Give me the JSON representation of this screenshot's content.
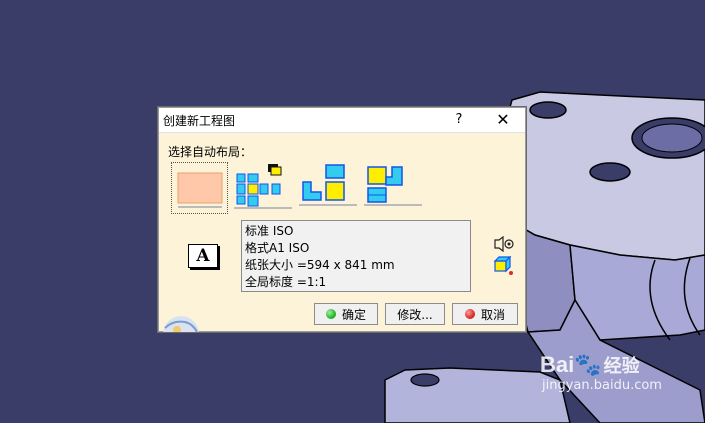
{
  "dialog": {
    "title": "创建新工程图",
    "help_label": "?",
    "close_label": "✕",
    "section_label": "选择自动布局：",
    "layout_options": [
      {
        "name": "empty-sheet"
      },
      {
        "name": "all-views"
      },
      {
        "name": "front-bottom-right"
      },
      {
        "name": "front-top-left"
      }
    ],
    "info": {
      "standard": "标准 ISO",
      "format": "格式A1 ISO",
      "sheet_size": "纸张大小 =594 x 841 mm",
      "scale": "全局标度 =1:1"
    },
    "font_icon_letter": "A",
    "buttons": {
      "ok": "确定",
      "modify": "修改...",
      "cancel": "取消"
    },
    "colors": {
      "ok_dot": "#2bb52b",
      "cancel_dot": "#e02a2a",
      "dialog_bg": "#fcf3d9",
      "accent_yellow": "#ffee00",
      "accent_cyan": "#33ccee",
      "accent_blue": "#1155ee"
    }
  },
  "watermark": {
    "brand": "Bai",
    "brand2": "经验",
    "url": "jingyan.baidu.com"
  }
}
